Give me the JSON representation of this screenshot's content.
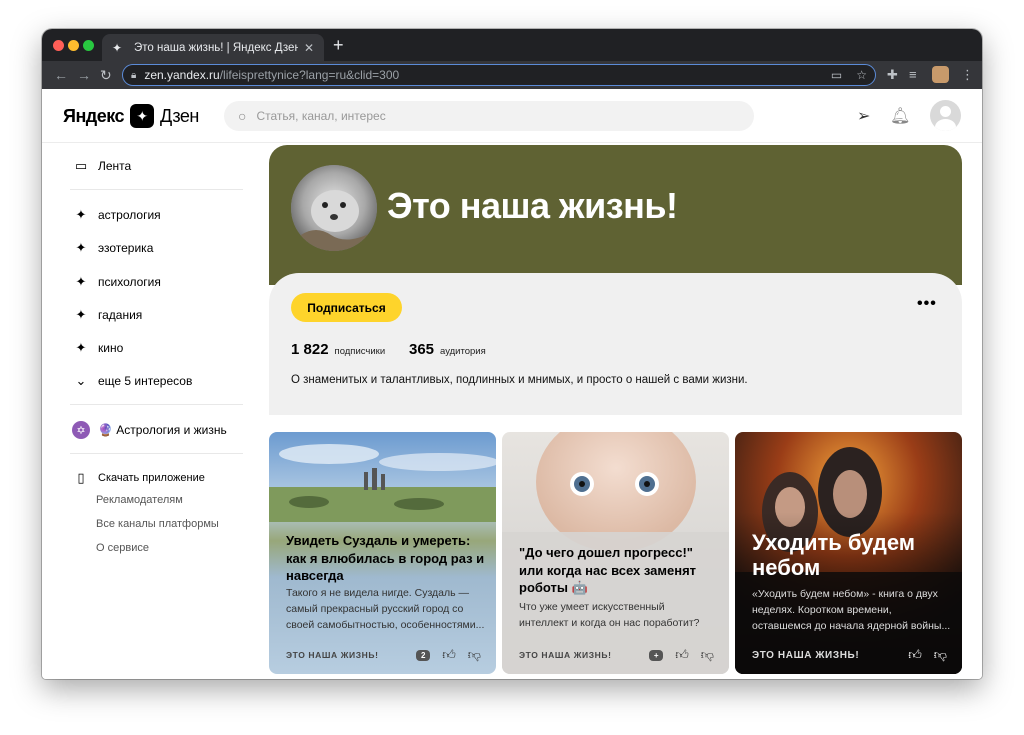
{
  "browser": {
    "tab_title": "Это наша жизнь! | Яндекс Дзен",
    "tab_icon": "sparkle-icon",
    "url_host": "zen.yandex.ru",
    "url_path": "/lifeisprettynice?lang=ru&clid=300"
  },
  "header": {
    "logo_left": "Яндекс",
    "logo_right": "Дзен",
    "search_placeholder": "Статья, канал, интерес"
  },
  "sidebar": {
    "feed_label": "Лента",
    "interests": [
      "астрология",
      "эзотерика",
      "психология",
      "гадания",
      "кино"
    ],
    "more_label": "еще 5 интересов",
    "subscription_label": "🔮 Астрология и жизнь",
    "download_label": "Скачать приложение",
    "links": [
      "Рекламодателям",
      "Все каналы платформы",
      "О сервисе"
    ]
  },
  "channel": {
    "title": "Это наша жизнь!",
    "subscribe_label": "Подписаться",
    "more_label": "•••",
    "subscribers_count": "1 822",
    "subscribers_label": "подписчики",
    "audience_count": "365",
    "audience_label": "аудитория",
    "description": "О знаменитых и талантливых, подлинных и мнимых, и просто о нашей с вами жизни.",
    "band_color": "#5f6233"
  },
  "cards": [
    {
      "title": "Увидеть Суздаль и умереть: как я влюбилась в город раз и навсегда",
      "snippet": "Такого я не видела нигде. Суздаль — самый прекрасный русский город со своей самобытностью, особенностями...",
      "source": "ЭТО НАША ЖИЗНЬ!",
      "comments": "2"
    },
    {
      "title": "\"До чего дошел прогресс!\" или когда нас всех заменят роботы 🤖",
      "snippet": "Что уже умеет искусственный интеллект и когда он нас поработит?",
      "source": "ЭТО НАША ЖИЗНЬ!",
      "comments": "+"
    },
    {
      "title": "Уходить будем небом",
      "snippet": "«Уходить будем небом» - книга о двух неделях. Коротком времени, оставшемся до начала ядерной войны...",
      "source": "ЭТО НАША ЖИЗНЬ!"
    }
  ]
}
